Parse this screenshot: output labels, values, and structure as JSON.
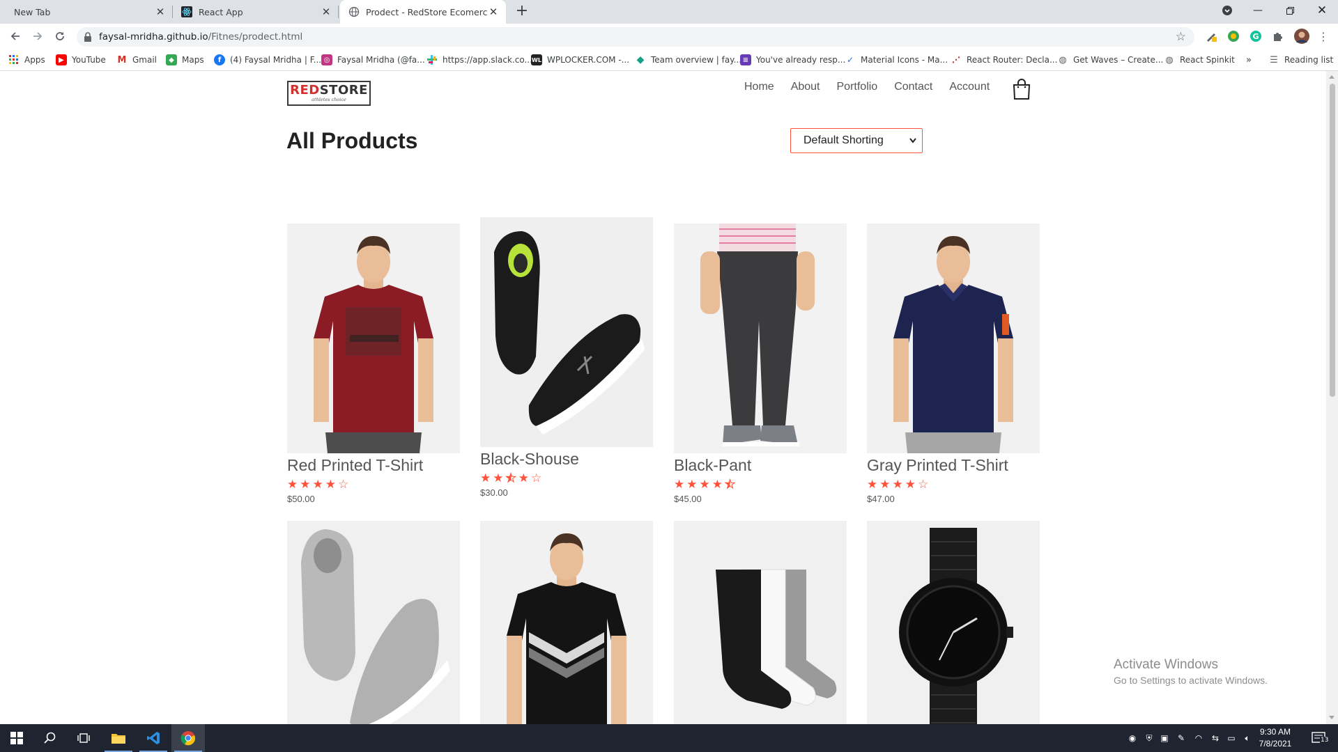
{
  "browser": {
    "tabs": [
      {
        "title": "New Tab",
        "active": false
      },
      {
        "title": "React App",
        "active": false
      },
      {
        "title": "Prodect - RedStore Ecomerce We",
        "active": true
      }
    ],
    "url_host": "faysal-mridha.github.io",
    "url_path": "/Fitnes/prodect.html",
    "bookmarks": [
      {
        "label": "Apps",
        "icon": "apps-grid-icon"
      },
      {
        "label": "YouTube",
        "icon": "youtube-icon"
      },
      {
        "label": "Gmail",
        "icon": "gmail-icon"
      },
      {
        "label": "Maps",
        "icon": "maps-icon"
      },
      {
        "label": "(4) Faysal Mridha | F...",
        "icon": "facebook-icon"
      },
      {
        "label": "Faysal Mridha (@fa...",
        "icon": "instagram-icon"
      },
      {
        "label": "https://app.slack.co...",
        "icon": "slack-icon"
      },
      {
        "label": "WPLOCKER.COM -...",
        "icon": "wplocker-icon"
      },
      {
        "label": "Team overview | fay...",
        "icon": "diamond-icon"
      },
      {
        "label": "You've already resp...",
        "icon": "form-icon"
      },
      {
        "label": "Material Icons - Ma...",
        "icon": "material-icon"
      },
      {
        "label": "React Router: Decla...",
        "icon": "react-router-icon"
      },
      {
        "label": "Get Waves – Create...",
        "icon": "globe-icon"
      },
      {
        "label": "React Spinkit",
        "icon": "globe-icon"
      }
    ],
    "reading_list": "Reading list",
    "more_bookmarks": "»"
  },
  "site": {
    "logo_red": "RED",
    "logo_black": "STORE",
    "logo_tagline": "athletes choice",
    "nav": [
      "Home",
      "About",
      "Portfolio",
      "Contact",
      "Account"
    ],
    "page_title": "All Products",
    "sort_selected": "Default Shorting"
  },
  "products": [
    {
      "name": "Red Printed T-Shirt",
      "price": "$50.00",
      "rating": 4,
      "image": "red-tshirt"
    },
    {
      "name": "Black-Shouse",
      "price": "$30.00",
      "rating": 3.5,
      "image": "black-shoes"
    },
    {
      "name": "Black-Pant",
      "price": "$45.00",
      "rating": 4.5,
      "image": "black-pant"
    },
    {
      "name": "Gray Printed T-Shirt",
      "price": "$47.00",
      "rating": 4,
      "image": "navy-polo"
    },
    {
      "name": "",
      "price": "",
      "rating": 0,
      "image": "gray-sneakers"
    },
    {
      "name": "",
      "price": "",
      "rating": 0,
      "image": "black-puma-tshirt"
    },
    {
      "name": "",
      "price": "",
      "rating": 0,
      "image": "socks"
    },
    {
      "name": "",
      "price": "",
      "rating": 0,
      "image": "black-watch"
    }
  ],
  "watermark": {
    "line1": "Activate Windows",
    "line2": "Go to Settings to activate Windows."
  },
  "taskbar": {
    "time": "9:30 AM",
    "date": "7/8/2021",
    "notifications": "13"
  },
  "colors": {
    "accent": "#ff523b",
    "tab_strip": "#dee1e6",
    "taskbar": "#1f2530"
  }
}
